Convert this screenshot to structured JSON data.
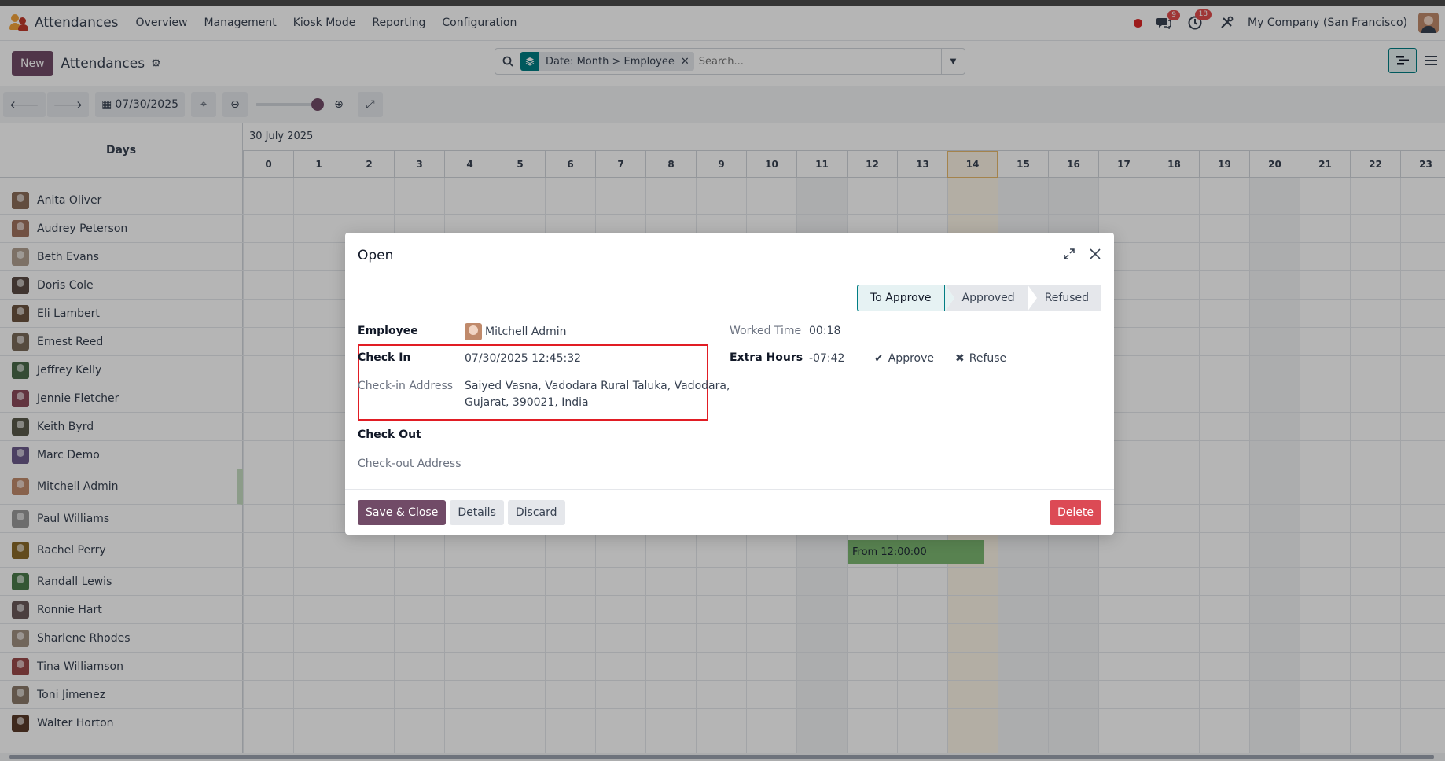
{
  "navbar": {
    "app_name": "Attendances",
    "menu": [
      "Overview",
      "Management",
      "Kiosk Mode",
      "Reporting",
      "Configuration"
    ],
    "messages_badge": "9",
    "activities_badge": "18",
    "company": "My Company (San Francisco)"
  },
  "control": {
    "new_label": "New",
    "title": "Attendances",
    "facet": "Date: Month > Employee",
    "search_placeholder": "Search..."
  },
  "toolbar": {
    "date": "07/30/2025"
  },
  "gantt": {
    "rows_header": "Days",
    "period_label": "30 July 2025",
    "hours": [
      "0",
      "1",
      "2",
      "3",
      "4",
      "5",
      "6",
      "7",
      "8",
      "9",
      "10",
      "11",
      "12",
      "13",
      "14",
      "15",
      "16",
      "17",
      "18",
      "19",
      "20",
      "21",
      "22",
      "23"
    ],
    "today_hour": "14",
    "employees": [
      {
        "name": "Anita Oliver",
        "color": "#8a6d5a"
      },
      {
        "name": "Audrey Peterson",
        "color": "#a0725f"
      },
      {
        "name": "Beth Evans",
        "color": "#b0a090"
      },
      {
        "name": "Doris Cole",
        "color": "#5b4b44"
      },
      {
        "name": "Eli Lambert",
        "color": "#6b5340"
      },
      {
        "name": "Ernest Reed",
        "color": "#7a6a5a"
      },
      {
        "name": "Jeffrey Kelly",
        "color": "#4a6a4a"
      },
      {
        "name": "Jennie Fletcher",
        "color": "#8a4a5a"
      },
      {
        "name": "Keith Byrd",
        "color": "#5a5a4a"
      },
      {
        "name": "Marc Demo",
        "color": "#6b5b8a"
      },
      {
        "name": "Mitchell Admin",
        "color": "#c08a6b"
      },
      {
        "name": "Paul Williams",
        "color": "#9a9a9a"
      },
      {
        "name": "Rachel Perry",
        "color": "#8a6a2a"
      },
      {
        "name": "Randall Lewis",
        "color": "#4a7a4a"
      },
      {
        "name": "Ronnie Hart",
        "color": "#6a5a5a"
      },
      {
        "name": "Sharlene Rhodes",
        "color": "#a09080"
      },
      {
        "name": "Tina Williamson",
        "color": "#9a4a4a"
      },
      {
        "name": "Toni Jimenez",
        "color": "#8a7a6a"
      },
      {
        "name": "Walter Horton",
        "color": "#5a3a2a"
      }
    ],
    "pill_label": "From 12:00:00"
  },
  "modal": {
    "title": "Open",
    "status_steps": [
      "To Approve",
      "Approved",
      "Refused"
    ],
    "employee_label": "Employee",
    "employee_value": "Mitchell Admin",
    "checkin_label": "Check In",
    "checkin_value": "07/30/2025 12:45:32",
    "checkin_address_label": "Check-in Address",
    "checkin_address_line1": "Saiyed Vasna, Vadodara Rural Taluka, Vadodara,",
    "checkin_address_line2": "Gujarat, 390021, India",
    "checkout_label": "Check Out",
    "checkout_address_label": "Check-out Address",
    "worked_time_label": "Worked Time",
    "worked_time_value": "00:18",
    "extra_hours_label": "Extra Hours",
    "extra_hours_value": "-07:42",
    "approve_label": "Approve",
    "refuse_label": "Refuse",
    "save_close_label": "Save & Close",
    "details_label": "Details",
    "discard_label": "Discard",
    "delete_label": "Delete"
  }
}
